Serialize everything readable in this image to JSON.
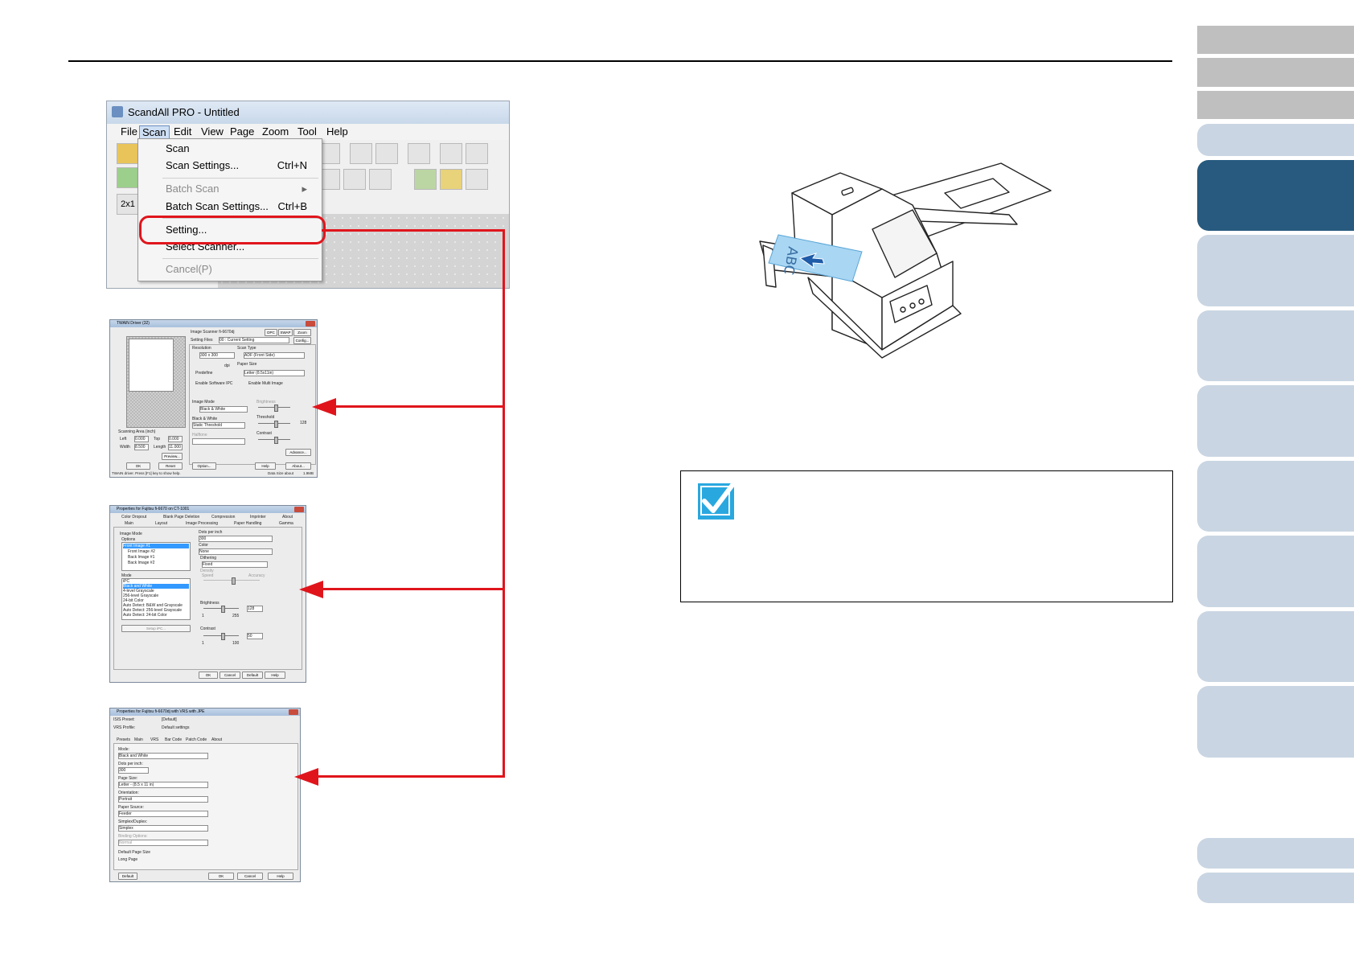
{
  "app": {
    "title": "ScandAll PRO - Untitled",
    "menu": [
      "File",
      "Scan",
      "Edit",
      "View",
      "Page",
      "Zoom",
      "Tool",
      "Help"
    ],
    "zoom_button": "2x1"
  },
  "scan_menu": {
    "items": [
      {
        "label": "Scan",
        "shortcut": "",
        "disabled": false
      },
      {
        "label": "Scan Settings...",
        "shortcut": "Ctrl+N",
        "disabled": false
      },
      {
        "label": "Batch Scan",
        "shortcut": "",
        "disabled": true
      },
      {
        "label": "Batch Scan Settings...",
        "shortcut": "Ctrl+B",
        "disabled": false
      },
      {
        "label": "Setting...",
        "shortcut": "",
        "disabled": false
      },
      {
        "label": "Select Scanner...",
        "shortcut": "",
        "disabled": false
      },
      {
        "label": "Cancel(P)",
        "shortcut": "",
        "disabled": true
      }
    ],
    "submenu_arrow": "▸"
  },
  "twain_dialog": {
    "title": "TWAIN Driver (32)",
    "scanner": "Image Scanner   fi-6670dj",
    "setting_files_label": "Setting Files",
    "setting_files_value": "00 : Current Setting",
    "config_button": "Config...",
    "dpc_button": "DPC",
    "swap_button": "SWAP",
    "preview_button": "Preview...",
    "resolution_label": "Resolution",
    "resolution_value": "300 x 300",
    "scan_type_label": "Scan Type",
    "scan_type_value": "ADF (Front Side)",
    "predefine": "Predefine",
    "paper_size_label": "Paper Size",
    "paper_size_value": "Letter (8.5x11in)",
    "enable_ipc": "Enable Software IPC",
    "enable_multiimage": "Enable Multi Image",
    "dpi": "dpi",
    "image_mode_label": "Image Mode",
    "image_mode_value": "Black & White",
    "brightness_label": "Brightness",
    "black_white_label": "Black & White",
    "threshold_label": "Threshold",
    "threshold_value": "128",
    "static_threshold": "Static Threshold",
    "contrast_label": "Contrast",
    "halftone_label": "Halftone",
    "scanning_area": "Scanning Area (inch)",
    "left_label": "Left",
    "left_value": "0.000",
    "top_label": "Top",
    "top_value": "0.000",
    "width_label": "Width",
    "width_value": "8.500",
    "length_label": "Length",
    "length_value": "11.000",
    "advance_button": "Advance...",
    "ok_button": "OK",
    "reset_button": "Reset",
    "option_button": "Option...",
    "help_button": "Help",
    "about_button": "About...",
    "zoom_button": "Zoom",
    "status": "TWAIN driver. Press [F1] key to show help.",
    "data_size_label": "Data Size about",
    "data_size_value": "1.9MB"
  },
  "isis_dialog": {
    "title": "Properties for Fujitsu fi-6670 on CT-1001",
    "tabs_row1": [
      "Color Dropout",
      "Blank Page Deletion",
      "Compression",
      "Imprinter",
      "About"
    ],
    "tabs_row2": [
      "Main",
      "Layout",
      "Image Processing",
      "Paper Handling",
      "Gamma"
    ],
    "image_mode_label": "Image Mode",
    "options_label": "Options",
    "option_items": [
      "Front Image #1",
      "Front Image #2",
      "Back Image #1",
      "Back Image #2"
    ],
    "mode_label": "Mode",
    "mode_items": [
      "iPC",
      "Black and White",
      "4-level Grayscale",
      "256-level Grayscale",
      "24-bit Color",
      "Auto Detect: B&W and Grayscale",
      "Auto Detect: 256-level Grayscale",
      "Auto Detect: 24-bit Color"
    ],
    "setup_button": "Setup iPC...",
    "dpi_label": "Dots per inch",
    "dpi_value": "300",
    "color_label": "Color",
    "color_value": "None",
    "dithering_label": "Dithering",
    "dithering_value": "Fixed",
    "density_label": "Density",
    "speed_label": "Speed",
    "accuracy_label": "Accuracy",
    "brightness_label": "Brightness",
    "brightness_value": "128",
    "contrast_label": "Contrast",
    "contrast_value": "50",
    "min_value": "1",
    "max_b": "255",
    "max_c": "100",
    "ok_button": "OK",
    "cancel_button": "Cancel",
    "default_button": "Default",
    "help_button": "Help"
  },
  "vrs_dialog": {
    "title": "Properties for Fujitsu fi-6670dj with VRS with JPE",
    "isis_preset_label": "ISIS Preset:",
    "isis_preset_value": "[Default]",
    "vrs_profile_label": "VRS Profile:",
    "vrs_profile_value": "Default settings",
    "tabs": [
      "Presets",
      "Main",
      "VRS",
      "Bar Code",
      "Patch Code",
      "About"
    ],
    "mode_label": "Mode:",
    "mode_value": "Black and White",
    "dpi_label": "Dots per inch:",
    "dpi_value": "300",
    "page_size_label": "Page Size:",
    "page_size_value": "Letter - (8.5 x 11 in)",
    "orientation_label": "Orientation:",
    "orientation_value": "Portrait",
    "paper_source_label": "Paper Source:",
    "paper_source_value": "Feeder",
    "simplex_label": "Simplex/Duplex:",
    "simplex_value": "Simplex",
    "binding_label": "Binding Options:",
    "binding_value": "Normal",
    "default_page_size": "Default Page Size",
    "long_page": "Long Page",
    "default_button": "Default",
    "ok_button": "OK",
    "cancel_button": "Cancel",
    "help_button": "Help"
  },
  "illustration": {
    "paper_text": "ABC"
  },
  "colors": {
    "accent_red": "#e0151c",
    "nav_active": "#275a7e",
    "nav_light": "#c9d5e2",
    "nav_grey": "#bfbfbf",
    "hint_icon": "#29a8df",
    "paper_blue": "#a9d6f3"
  }
}
